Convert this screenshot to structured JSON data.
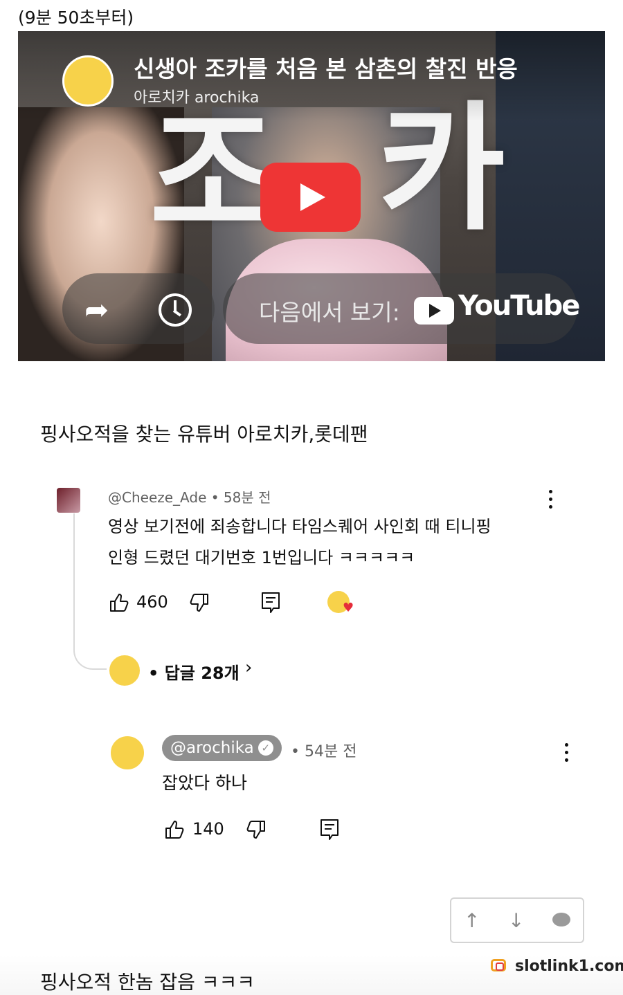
{
  "header": {
    "note": "(9분 50초부터)"
  },
  "video": {
    "title": "신생아 조카를 처음 본 삼촌의 찰진 반응",
    "channel": "아로치카 arochika",
    "thumbnail_text_left": "조",
    "thumbnail_text_right": "카",
    "watch_on_label": "다음에서 보기:",
    "youtube_label": "YouTube",
    "icons": [
      "play-icon",
      "share-icon",
      "clock-icon",
      "youtube-logo-icon"
    ],
    "colors": {
      "play_button": "#ee3535"
    }
  },
  "caption": "핑사오적을 찾는 유튜버 아로치카,롯데팬",
  "comment": {
    "meta": "@Cheeze_Ade • 58분 전",
    "text_line1": "영상 보기전에 죄송합니다 타임스퀘어 사인회 때 티니핑",
    "text_line2": "인형 드렸던 대기번호 1번입니다 ㅋㅋㅋㅋㅋ",
    "likes": "460",
    "replies_label": "• 답글 28개",
    "replies_chevron": "›"
  },
  "reply": {
    "author": "@arochika",
    "time": "• 54분 전",
    "text": "잡았다 하나",
    "likes": "140"
  },
  "floating_nav": {
    "up": "↑",
    "down": "↓"
  },
  "watermark": "slotlink1.com",
  "bottom_caption": "핑사오적 한놈 잡음 ㅋㅋㅋ"
}
